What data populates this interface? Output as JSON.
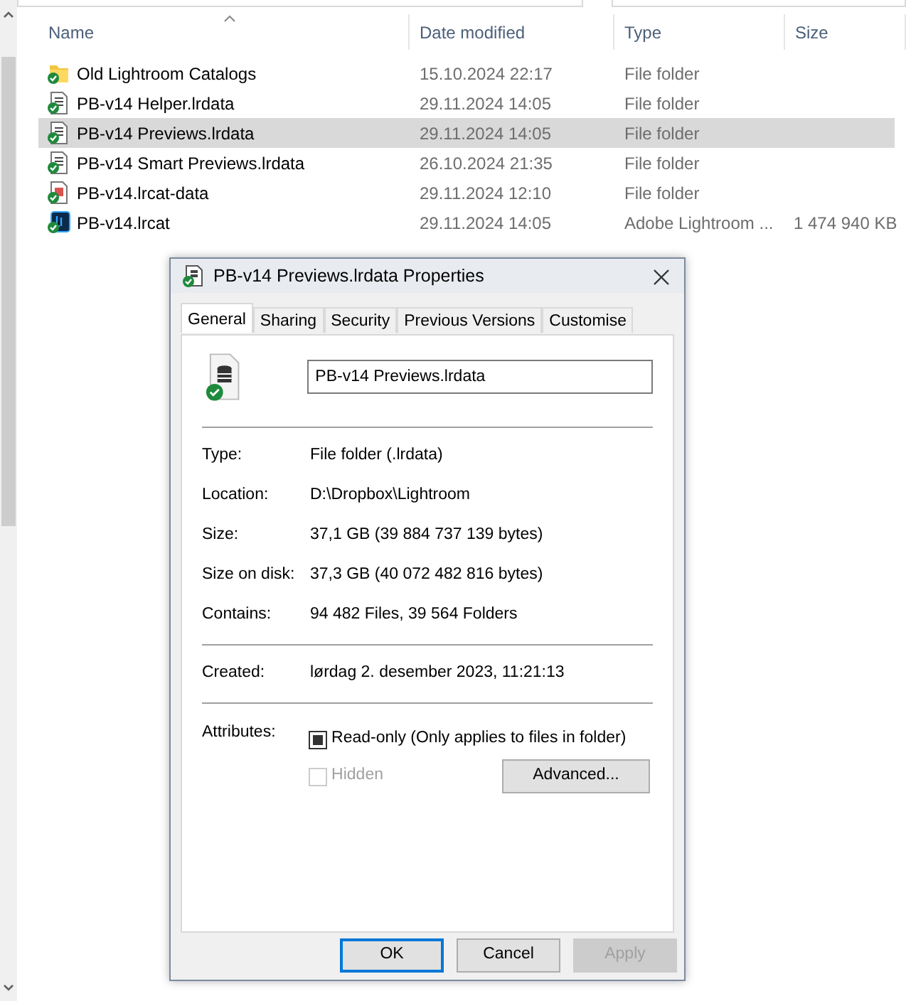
{
  "explorer": {
    "columns": [
      {
        "label": "Name",
        "sorted": true
      },
      {
        "label": "Date modified",
        "sorted": false
      },
      {
        "label": "Type",
        "sorted": false
      },
      {
        "label": "Size",
        "sorted": false
      }
    ],
    "rows": [
      {
        "kind": "folder",
        "name": "Old Lightroom Catalogs",
        "date": "15.10.2024 22:17",
        "type": "File folder",
        "selected": false
      },
      {
        "kind": "data",
        "name": "PB-v14 Helper.lrdata",
        "date": "29.11.2024 14:05",
        "type": "File folder",
        "selected": false
      },
      {
        "kind": "data",
        "name": "PB-v14 Previews.lrdata",
        "date": "29.11.2024 14:05",
        "type": "File folder",
        "selected": true
      },
      {
        "kind": "data",
        "name": "PB-v14 Smart Previews.lrdata",
        "date": "26.10.2024 21:35",
        "type": "File folder",
        "selected": false
      },
      {
        "kind": "catdata",
        "name": "PB-v14.lrcat-data",
        "date": "29.11.2024 12:10",
        "type": "File folder",
        "selected": false
      },
      {
        "kind": "catalog",
        "name": "PB-v14.lrcat",
        "date": "29.11.2024 14:05",
        "type": "Adobe Lightroom ...",
        "size": "1 474 940 KB",
        "selected": false
      }
    ]
  },
  "dialog": {
    "title": "PB-v14 Previews.lrdata Properties",
    "tabs": [
      {
        "label": "General",
        "selected": true
      },
      {
        "label": "Sharing",
        "selected": false
      },
      {
        "label": "Security",
        "selected": false
      },
      {
        "label": "Previous Versions",
        "selected": false
      },
      {
        "label": "Customise",
        "selected": false
      }
    ],
    "name_value": "PB-v14 Previews.lrdata",
    "groups": [
      [
        {
          "label": "Type:",
          "value": "File folder (.lrdata)"
        },
        {
          "label": "Location:",
          "value": "D:\\Dropbox\\Lightroom"
        },
        {
          "label": "Size:",
          "value": "37,1 GB (39 884 737 139 bytes)"
        },
        {
          "label": "Size on disk:",
          "value": "37,3 GB (40 072 482 816 bytes)"
        },
        {
          "label": "Contains:",
          "value": "94 482 Files, 39 564 Folders"
        }
      ],
      [
        {
          "label": "Created:",
          "value": "lørdag 2. desember 2023, 11:21:13"
        }
      ]
    ],
    "attributes_label": "Attributes:",
    "attributes": [
      {
        "label": "Read-only (Only applies to files in folder)",
        "mixed": true,
        "disabled": false
      },
      {
        "label": "Hidden",
        "mixed": false,
        "disabled": true
      }
    ],
    "advanced_button": "Advanced...",
    "buttons": [
      {
        "label": "OK",
        "default": true,
        "disabled": false
      },
      {
        "label": "Cancel",
        "default": false,
        "disabled": false
      },
      {
        "label": "Apply",
        "default": false,
        "disabled": true
      }
    ]
  }
}
